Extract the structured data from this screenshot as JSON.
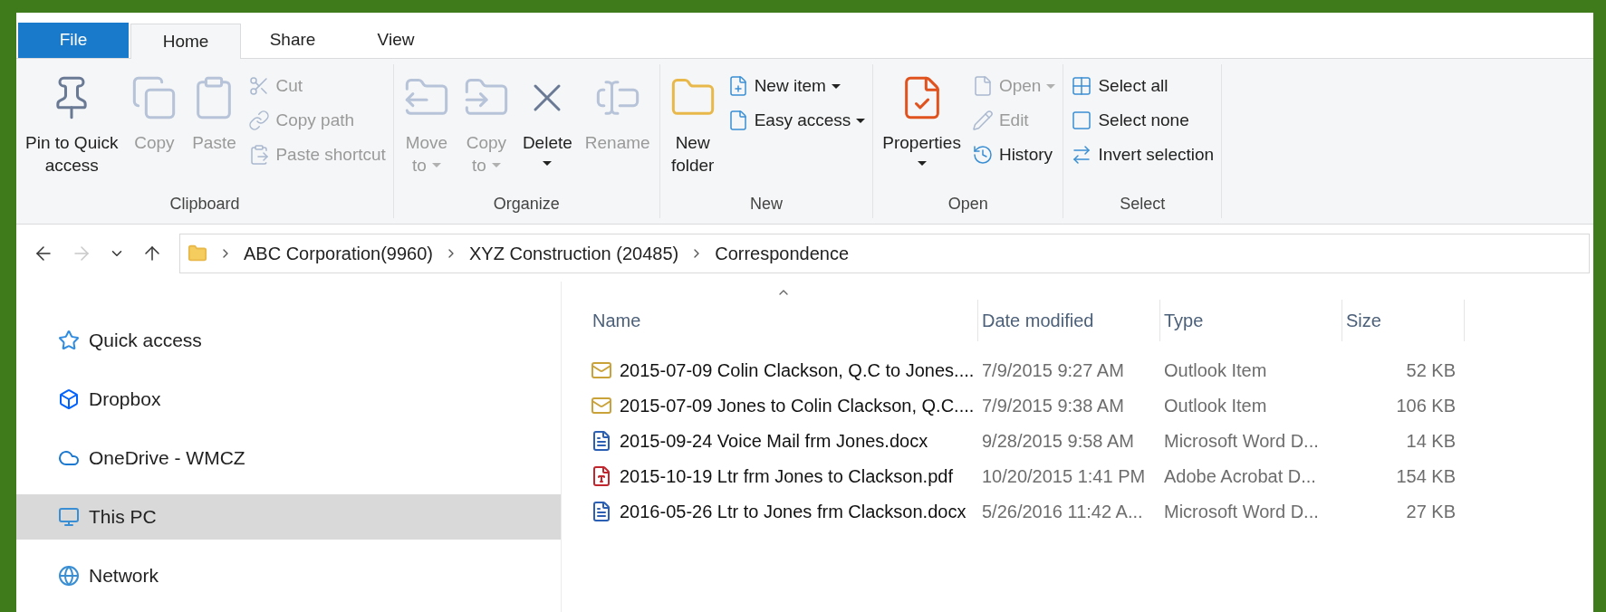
{
  "tabs": [
    {
      "label": "File",
      "kind": "file",
      "selected": false
    },
    {
      "label": "Home",
      "kind": "tab",
      "selected": true
    },
    {
      "label": "Share",
      "kind": "tab",
      "selected": false
    },
    {
      "label": "View",
      "kind": "tab",
      "selected": false
    }
  ],
  "ribbon": [
    {
      "label": "Clipboard",
      "items": [
        {
          "kind": "large",
          "lines": [
            "Pin to Quick",
            "access"
          ],
          "disabled": false,
          "dropdown": false
        },
        {
          "kind": "large",
          "lines": [
            "Copy"
          ],
          "disabled": true,
          "dropdown": false
        },
        {
          "kind": "large",
          "lines": [
            "Paste"
          ],
          "disabled": true,
          "dropdown": false
        },
        {
          "kind": "stack",
          "items": [
            {
              "label": "Cut",
              "disabled": true,
              "dropdown": false
            },
            {
              "label": "Copy path",
              "disabled": true,
              "dropdown": false
            },
            {
              "label": "Paste shortcut",
              "disabled": true,
              "dropdown": false
            }
          ]
        }
      ]
    },
    {
      "label": "Organize",
      "items": [
        {
          "kind": "large",
          "lines": [
            "Move",
            "to"
          ],
          "disabled": true,
          "dropdown": true
        },
        {
          "kind": "large",
          "lines": [
            "Copy",
            "to"
          ],
          "disabled": true,
          "dropdown": true
        },
        {
          "kind": "large",
          "lines": [
            "Delete"
          ],
          "disabled": false,
          "dropdown": true
        },
        {
          "kind": "large",
          "lines": [
            "Rename"
          ],
          "disabled": true,
          "dropdown": false
        }
      ]
    },
    {
      "label": "New",
      "items": [
        {
          "kind": "large",
          "lines": [
            "New",
            "folder"
          ],
          "disabled": false,
          "dropdown": false
        },
        {
          "kind": "stack",
          "items": [
            {
              "label": "New item",
              "disabled": false,
              "dropdown": true
            },
            {
              "label": "Easy access",
              "disabled": false,
              "dropdown": true
            }
          ]
        }
      ]
    },
    {
      "label": "Open",
      "items": [
        {
          "kind": "large",
          "lines": [
            "Properties"
          ],
          "disabled": false,
          "dropdown": true
        },
        {
          "kind": "stack",
          "items": [
            {
              "label": "Open",
              "disabled": true,
              "dropdown": true
            },
            {
              "label": "Edit",
              "disabled": true,
              "dropdown": false
            },
            {
              "label": "History",
              "disabled": false,
              "dropdown": false
            }
          ]
        }
      ]
    },
    {
      "label": "Select",
      "items": [
        {
          "kind": "stack",
          "items": [
            {
              "label": "Select all",
              "disabled": false,
              "dropdown": false
            },
            {
              "label": "Select none",
              "disabled": false,
              "dropdown": false
            },
            {
              "label": "Invert selection",
              "disabled": false,
              "dropdown": false
            }
          ]
        }
      ]
    }
  ],
  "navigation": {
    "back": {
      "disabled": false
    },
    "forward": {
      "disabled": true
    }
  },
  "address_bar": {
    "crumbs": [
      "ABC Corporation(9960)",
      "XYZ Construction (20485)",
      "Correspondence"
    ]
  },
  "sidebar": {
    "items": [
      {
        "label": "Quick access",
        "kind": "star",
        "selected": false
      },
      {
        "label": "Dropbox",
        "kind": "dropbox",
        "selected": false
      },
      {
        "label": "OneDrive - WMCZ",
        "kind": "cloud",
        "selected": false
      },
      {
        "label": "This PC",
        "kind": "pc",
        "selected": true
      },
      {
        "label": "Network",
        "kind": "network",
        "selected": false
      }
    ]
  },
  "table": {
    "columns": [
      "Name",
      "Date modified",
      "Type",
      "Size"
    ],
    "rows": [
      {
        "kind": "mail",
        "name": "2015-07-09 Colin Clackson, Q.C to Jones....",
        "date": "7/9/2015 9:27 AM",
        "type": "Outlook Item",
        "size": "52 KB"
      },
      {
        "kind": "mail",
        "name": "2015-07-09 Jones to Colin Clackson, Q.C....",
        "date": "7/9/2015 9:38 AM",
        "type": "Outlook Item",
        "size": "106 KB"
      },
      {
        "kind": "word",
        "name": "2015-09-24 Voice Mail frm Jones.docx",
        "date": "9/28/2015 9:58 AM",
        "type": "Microsoft Word D...",
        "size": "14 KB"
      },
      {
        "kind": "pdf",
        "name": "2015-10-19 Ltr frm Jones to Clackson.pdf",
        "date": "10/20/2015 1:41 PM",
        "type": "Adobe Acrobat D...",
        "size": "154 KB"
      },
      {
        "kind": "word",
        "name": "2016-05-26 Ltr to Jones frm Clackson.docx",
        "date": "5/26/2016 11:42 A...",
        "type": "Microsoft Word D...",
        "size": "27 KB"
      }
    ]
  }
}
